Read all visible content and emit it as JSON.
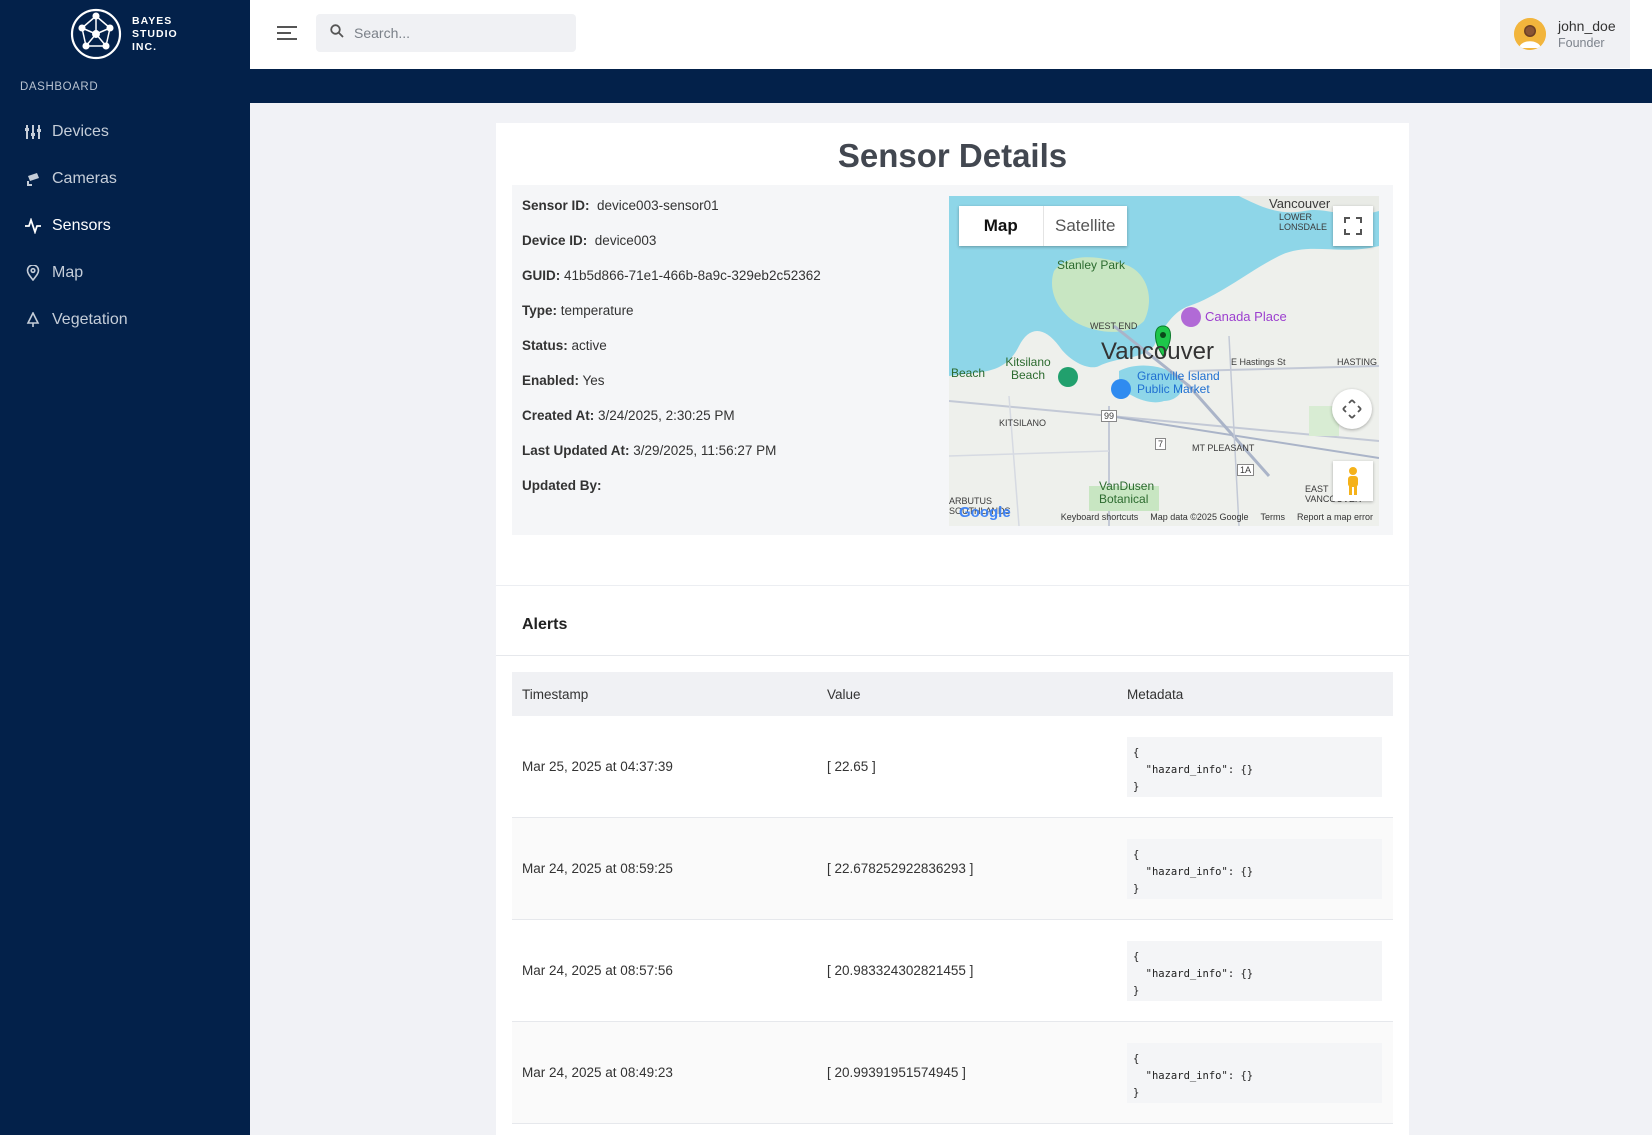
{
  "sidebar": {
    "logo_lines": [
      "BAYES",
      "STUDIO",
      "INC."
    ],
    "section_label": "DASHBOARD",
    "items": [
      {
        "label": "Devices",
        "icon": "sliders-icon"
      },
      {
        "label": "Cameras",
        "icon": "camera-icon"
      },
      {
        "label": "Sensors",
        "icon": "sensor-icon",
        "active": true
      },
      {
        "label": "Map",
        "icon": "map-pin-icon"
      },
      {
        "label": "Vegetation",
        "icon": "tree-icon"
      }
    ]
  },
  "header": {
    "search_placeholder": "Search...",
    "user": {
      "name": "john_doe",
      "role": "Founder"
    }
  },
  "page": {
    "title": "Sensor Details",
    "fields": [
      {
        "label": "Sensor ID:",
        "value": "device003-sensor01"
      },
      {
        "label": "Device ID:",
        "value": "device003"
      },
      {
        "label": "GUID:",
        "value": "41b5d866-71e1-466b-8a9c-329eb2c52362"
      },
      {
        "label": "Type:",
        "value": "temperature"
      },
      {
        "label": "Status:",
        "value": "active"
      },
      {
        "label": "Enabled:",
        "value": "Yes"
      },
      {
        "label": "Created At:",
        "value": "3/24/2025, 2:30:25 PM"
      },
      {
        "label": "Last Updated At:",
        "value": "3/29/2025, 11:56:27 PM"
      },
      {
        "label": "Updated By:",
        "value": ""
      }
    ]
  },
  "map": {
    "btn_map": "Map",
    "btn_satellite": "Satellite",
    "footer": [
      "Keyboard shortcuts",
      "Map data ©2025 Google",
      "Terms",
      "Report a map error"
    ],
    "labels": {
      "vancouver_top": "Vancouver",
      "lower_lonsdale": "LOWER LONSDALE",
      "stanley_park": "Stanley Park",
      "canada_place": "Canada Place",
      "west_end": "WEST END",
      "vancouver_main": "Vancouver",
      "hastings_st": "E Hastings St",
      "hastings": "HASTING",
      "beach": "Beach",
      "kitsilano_beach": "Kitsilano Beach",
      "granville": "Granville Island Public Market",
      "kitsilano": "KITSILANO",
      "mt_pleasant": "MT PLEASANT",
      "vandusen": "VanDusen Botanical",
      "east_van": "EAST VANCOUVER",
      "southlands": "ARBUTUS SOUTHLANDS",
      "google": "Google",
      "route_99": "99",
      "route_7": "7",
      "route_1a": "1A"
    }
  },
  "alerts": {
    "title": "Alerts",
    "columns": [
      "Timestamp",
      "Value",
      "Metadata"
    ],
    "rows": [
      {
        "timestamp": "Mar 25, 2025 at 04:37:39",
        "value": "[ 22.65 ]",
        "metadata": "{\n  \"hazard_info\": {}\n}"
      },
      {
        "timestamp": "Mar 24, 2025 at 08:59:25",
        "value": "[ 22.678252922836293 ]",
        "metadata": "{\n  \"hazard_info\": {}\n}"
      },
      {
        "timestamp": "Mar 24, 2025 at 08:57:56",
        "value": "[ 20.983324302821455 ]",
        "metadata": "{\n  \"hazard_info\": {}\n}"
      },
      {
        "timestamp": "Mar 24, 2025 at 08:49:23",
        "value": "[ 20.99391951574945 ]",
        "metadata": "{\n  \"hazard_info\": {}\n}"
      }
    ]
  },
  "colors": {
    "sidebar": "#03214a",
    "accent_green": "#1ec64a",
    "page_bg": "#f1f2f6"
  }
}
